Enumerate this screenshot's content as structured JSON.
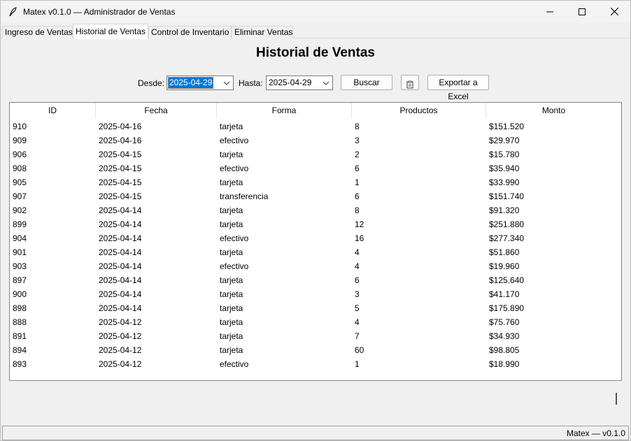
{
  "window": {
    "title": "Matex v0.1.0 — Administrador de Ventas",
    "icon": "feather-icon"
  },
  "tabs": [
    {
      "label": "Ingreso de Ventas",
      "active": false
    },
    {
      "label": "Historial de Ventas",
      "active": true
    },
    {
      "label": "Control de Inventario",
      "active": false
    },
    {
      "label": "Eliminar Ventas",
      "active": false
    }
  ],
  "page_title": "Historial de Ventas",
  "filters": {
    "desde_label": "Desde:",
    "desde_value": "2025-04-29",
    "hasta_label": "Hasta:",
    "hasta_value": "2025-04-29",
    "search_label": "Buscar",
    "icon_button": "clipboard-icon",
    "export_label": "Exportar a Excel"
  },
  "table": {
    "columns": [
      "ID",
      "Fecha",
      "Forma",
      "Productos",
      "Monto"
    ],
    "rows": [
      [
        "910",
        "2025-04-16",
        "tarjeta",
        "8",
        "$151.520"
      ],
      [
        "909",
        "2025-04-16",
        "efectivo",
        "3",
        "$29.970"
      ],
      [
        "906",
        "2025-04-15",
        "tarjeta",
        "2",
        "$15.780"
      ],
      [
        "908",
        "2025-04-15",
        "efectivo",
        "6",
        "$35.940"
      ],
      [
        "905",
        "2025-04-15",
        "tarjeta",
        "1",
        "$33.990"
      ],
      [
        "907",
        "2025-04-15",
        "transferencia",
        "6",
        "$151.740"
      ],
      [
        "902",
        "2025-04-14",
        "tarjeta",
        "8",
        "$91.320"
      ],
      [
        "899",
        "2025-04-14",
        "tarjeta",
        "12",
        "$251.880"
      ],
      [
        "904",
        "2025-04-14",
        "efectivo",
        "16",
        "$277.340"
      ],
      [
        "901",
        "2025-04-14",
        "tarjeta",
        "4",
        "$51.860"
      ],
      [
        "903",
        "2025-04-14",
        "efectivo",
        "4",
        "$19.960"
      ],
      [
        "897",
        "2025-04-14",
        "tarjeta",
        "6",
        "$125.640"
      ],
      [
        "900",
        "2025-04-14",
        "tarjeta",
        "3",
        "$41.170"
      ],
      [
        "898",
        "2025-04-14",
        "tarjeta",
        "5",
        "$175.890"
      ],
      [
        "888",
        "2025-04-12",
        "tarjeta",
        "4",
        "$75.760"
      ],
      [
        "891",
        "2025-04-12",
        "tarjeta",
        "7",
        "$34.930"
      ],
      [
        "894",
        "2025-04-12",
        "tarjeta",
        "60",
        "$98.805"
      ],
      [
        "893",
        "2025-04-12",
        "efectivo",
        "1",
        "$18.990"
      ]
    ]
  },
  "status": "Matex — v0.1.0",
  "colors": {
    "selection": "#0078d7",
    "window_bg": "#f0f0f0"
  }
}
